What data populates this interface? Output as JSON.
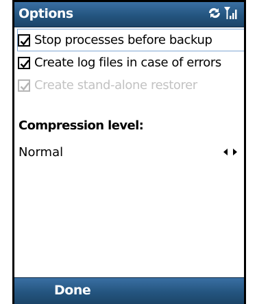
{
  "title_bar": {
    "title": "Options",
    "icons": [
      "sync-icon",
      "signal-strength-icon"
    ]
  },
  "options": [
    {
      "label": "Stop processes before backup",
      "checked": true,
      "enabled": true,
      "focused": true
    },
    {
      "label": "Create log files in case of errors",
      "checked": true,
      "enabled": true,
      "focused": false
    },
    {
      "label": "Create stand-alone restorer",
      "checked": true,
      "enabled": false,
      "focused": false
    }
  ],
  "compression": {
    "label": "Compression level:",
    "value": "Normal",
    "icons": [
      "arrow-left-icon",
      "arrow-right-icon"
    ]
  },
  "softkeys": {
    "left": "Done"
  },
  "colors": {
    "bar_top": "#3a6fa3",
    "bar_bottom": "#1c4569",
    "focus_outline": "#7fa7d3",
    "disabled_text": "#c2c2c2"
  }
}
